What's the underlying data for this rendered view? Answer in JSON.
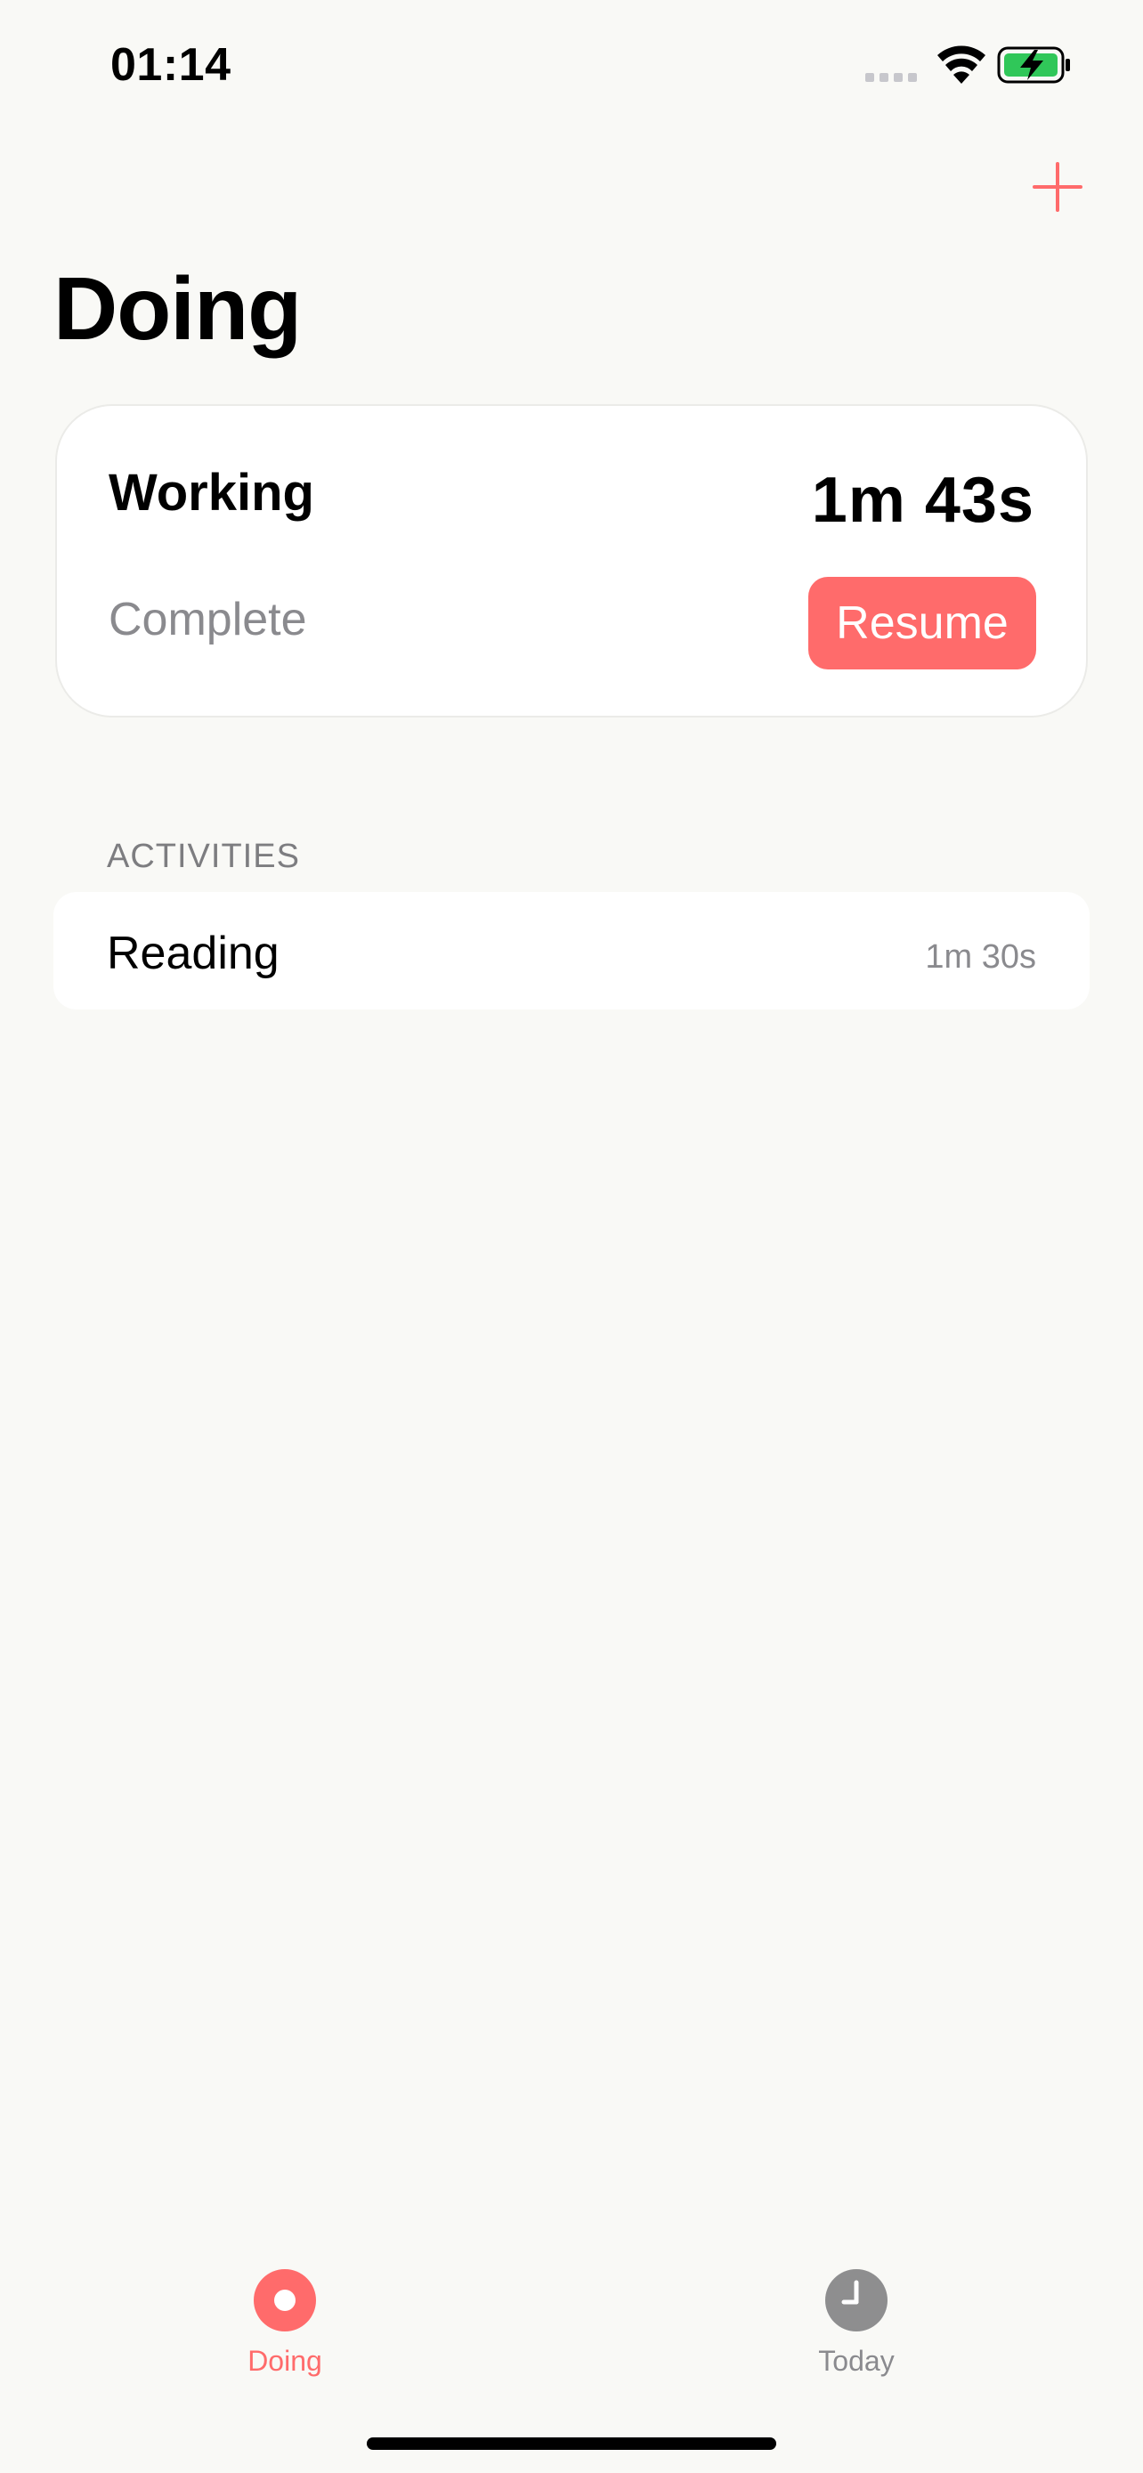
{
  "status_bar": {
    "time": "01:14"
  },
  "header": {
    "title": "Doing",
    "add_icon": "plus-icon"
  },
  "current": {
    "name": "Working",
    "elapsed": "1m 43s",
    "complete_label": "Complete",
    "resume_label": "Resume"
  },
  "activities": {
    "section_title": "ACTIVITIES",
    "items": [
      {
        "name": "Reading",
        "duration": "1m 30s"
      }
    ]
  },
  "tab_bar": {
    "tabs": [
      {
        "label": "Doing",
        "icon": "record-icon",
        "active": true
      },
      {
        "label": "Today",
        "icon": "clock-icon",
        "active": false
      }
    ]
  },
  "colors": {
    "accent": "#ff6b6b",
    "background": "#f9f9f6",
    "secondary_text": "#8a8a8e"
  }
}
